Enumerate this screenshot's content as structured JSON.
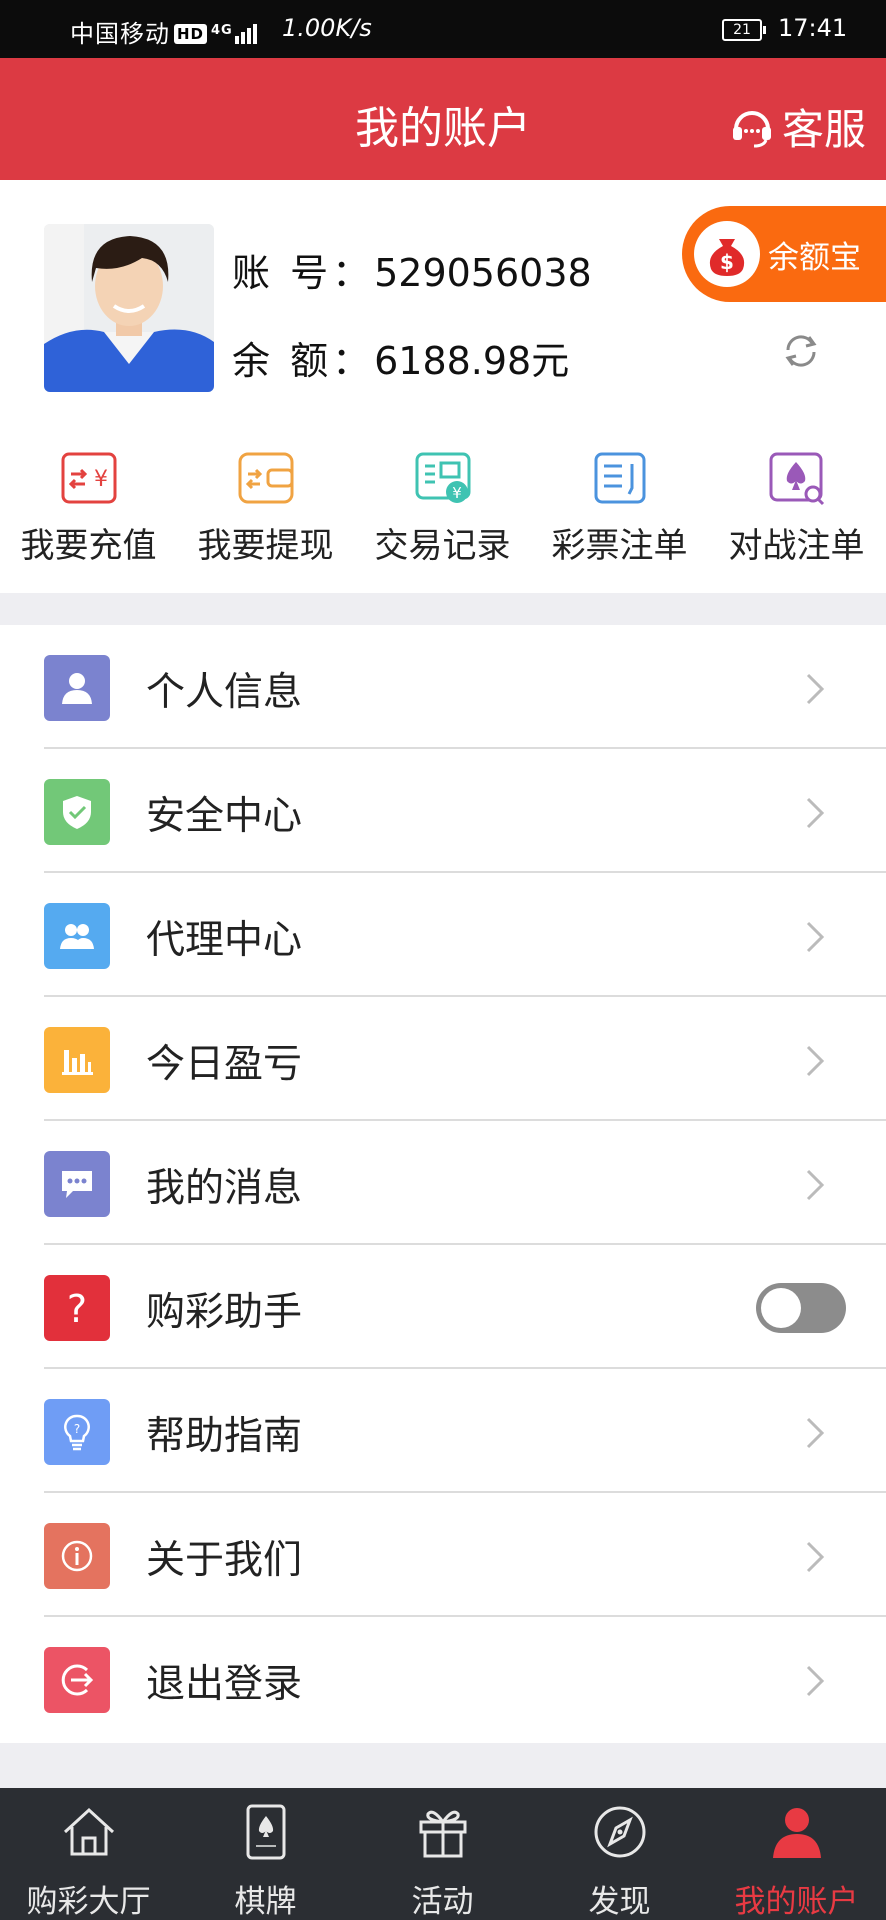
{
  "status_bar": {
    "carrier": "中国移动",
    "hd": "HD",
    "network": "4G",
    "speed": "1.00K/s",
    "battery": "21",
    "time": "17:41"
  },
  "header": {
    "title": "我的账户",
    "service_label": "客服"
  },
  "account": {
    "account_label": "账 号：",
    "account_value": "529056038",
    "balance_label": "余 额：",
    "balance_value": "6188.98元",
    "balance_treasure_label": "余额宝"
  },
  "quick_actions": [
    {
      "label": "我要充值",
      "icon": "recharge-icon",
      "color": "#e3423f"
    },
    {
      "label": "我要提现",
      "icon": "withdraw-icon",
      "color": "#f0a342"
    },
    {
      "label": "交易记录",
      "icon": "transaction-record-icon",
      "color": "#3fc3b2"
    },
    {
      "label": "彩票注单",
      "icon": "lottery-order-icon",
      "color": "#4b93de"
    },
    {
      "label": "对战注单",
      "icon": "battle-order-icon",
      "color": "#9a59b8"
    }
  ],
  "menu": [
    {
      "label": "个人信息",
      "icon": "person-icon",
      "color": "#7b83cf"
    },
    {
      "label": "安全中心",
      "icon": "shield-icon",
      "color": "#72c878"
    },
    {
      "label": "代理中心",
      "icon": "agents-icon",
      "color": "#55aaf0"
    },
    {
      "label": "今日盈亏",
      "icon": "bar-chart-icon",
      "color": "#fbb23a"
    },
    {
      "label": "我的消息",
      "icon": "message-icon",
      "color": "#7b83cf"
    },
    {
      "label": "购彩助手",
      "icon": "question-icon",
      "color": "#e2303b",
      "toggle": false
    },
    {
      "label": "帮助指南",
      "icon": "lightbulb-icon",
      "color": "#6f9df5"
    },
    {
      "label": "关于我们",
      "icon": "info-icon",
      "color": "#e4735f"
    },
    {
      "label": "退出登录",
      "icon": "logout-icon",
      "color": "#ec5465"
    }
  ],
  "tabs": [
    {
      "label": "购彩大厅",
      "icon": "home-icon"
    },
    {
      "label": "棋牌",
      "icon": "cards-icon"
    },
    {
      "label": "活动",
      "icon": "gift-icon"
    },
    {
      "label": "发现",
      "icon": "compass-icon"
    },
    {
      "label": "我的账户",
      "icon": "user-icon",
      "active": true
    }
  ],
  "colors": {
    "brand_red": "#dc3a43",
    "orange": "#fa6a10",
    "tabbar_bg": "#2b2e33",
    "active_tab": "#e83a43"
  }
}
